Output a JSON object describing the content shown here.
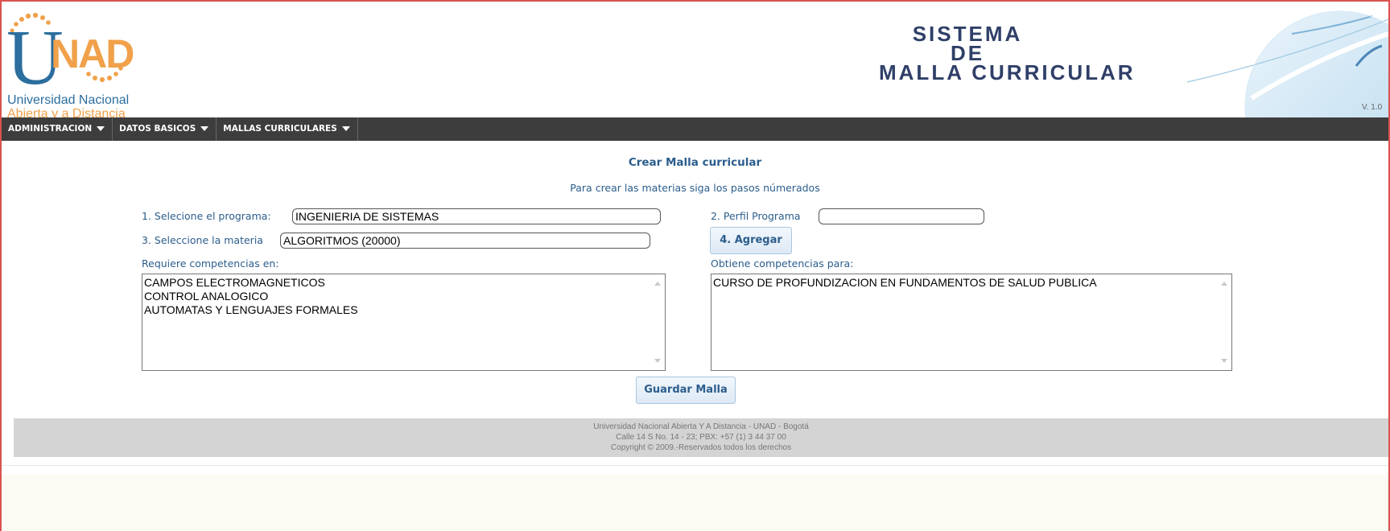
{
  "header": {
    "logo_text": "UNAD",
    "logo_line1": "Universidad Nacional",
    "logo_line2": "Abierta y a Distancia",
    "system_title_line1": "SISTEMA",
    "system_title_line2": "DE",
    "system_title_line3": "MALLA CURRICULAR",
    "version": "V. 1.0"
  },
  "nav": {
    "items": [
      {
        "label": "ADMINISTRACION"
      },
      {
        "label": "DATOS BASICOS"
      },
      {
        "label": "MALLAS CURRICULARES"
      }
    ]
  },
  "main": {
    "title": "Crear Malla curricular",
    "subtitle": "Para crear las materias siga los pasos númerados",
    "program_label": "1. Selecione el programa:",
    "program_value": "INGENIERIA DE SISTEMAS",
    "profile_label": "2. Perfil Programa",
    "profile_value": "",
    "subject_label": "3. Seleccione la materia",
    "subject_value": "ALGORITMOS (20000)",
    "add_button": "4. Agregar",
    "requires_label": "Requiere competencias en:",
    "requires_items": [
      "CAMPOS ELECTROMAGNETICOS",
      "CONTROL ANALOGICO",
      "AUTOMATAS Y LENGUAJES FORMALES"
    ],
    "obtains_label": "Obtiene competencias para:",
    "obtains_items": [
      "CURSO DE PROFUNDIZACION EN FUNDAMENTOS DE SALUD PUBLICA"
    ],
    "save_button": "Guardar Malla"
  },
  "footer": {
    "line1": "Universidad Nacional Abierta Y A Distancia - UNAD - Bogotá",
    "line2": "Calle 14 S No. 14 - 23; PBX: +57 (1) 3 44 37 00",
    "line3": "Copyright © 2009.-Reservados todos los derechos"
  },
  "colors": {
    "brand_blue": "#2b5d8c",
    "logo_orange": "#f0a14a",
    "nav_background": "#3d3d3d",
    "frame_border": "#d9534f"
  }
}
